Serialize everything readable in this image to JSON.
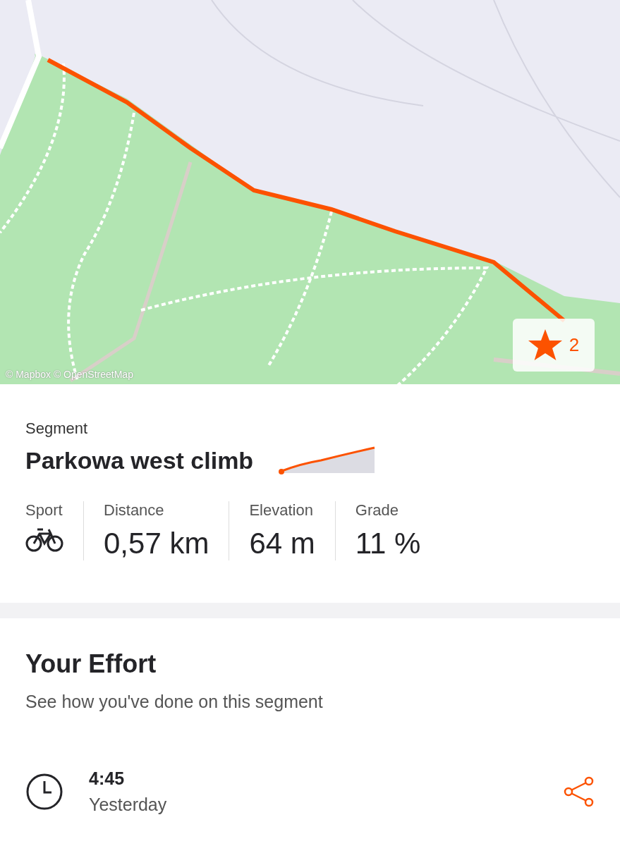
{
  "map": {
    "kind": "picture",
    "attribution": "© Mapbox © OpenStreetMap",
    "star_badge": {
      "count": "2"
    }
  },
  "segment": {
    "label": "Segment",
    "name": "Parkowa west climb",
    "stats": [
      {
        "kind": "icon",
        "label": "Sport"
      },
      {
        "kind": "text",
        "label": "Distance",
        "value": "0,57 km"
      },
      {
        "kind": "text",
        "label": "Elevation",
        "value": "64 m"
      },
      {
        "kind": "text",
        "label": "Grade",
        "value": "11 %"
      }
    ]
  },
  "effort": {
    "title": "Your Effort",
    "subtitle": "See how you've done on this segment",
    "entries": [
      {
        "time": "4:45",
        "date": "Yesterday"
      }
    ]
  }
}
